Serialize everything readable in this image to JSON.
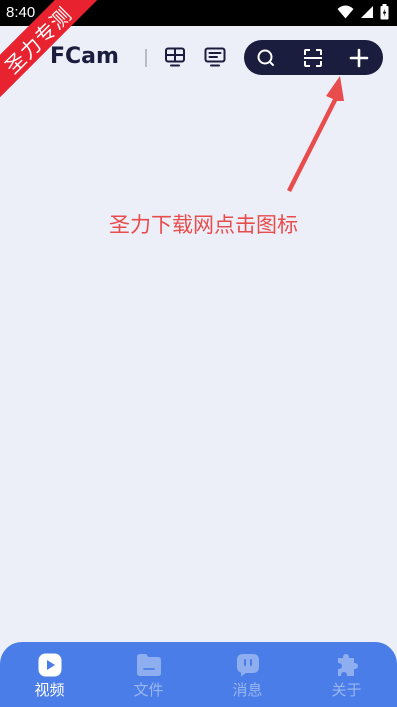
{
  "status_bar": {
    "time": "8:40",
    "icons": [
      "wifi-icon",
      "signal-icon",
      "battery-icon"
    ]
  },
  "ribbon": {
    "text": "圣力专测"
  },
  "header": {
    "brand": "FCam",
    "icons": [
      "grid-view-icon",
      "monitor-icon"
    ],
    "toolbar": [
      "search-icon",
      "scan-icon",
      "add-icon"
    ]
  },
  "annotation": {
    "text": "圣力下载网点击图标"
  },
  "bottom_nav": {
    "items": [
      {
        "label": "视频",
        "icon": "video-play-icon",
        "active": true
      },
      {
        "label": "文件",
        "icon": "folder-icon",
        "active": false
      },
      {
        "label": "消息",
        "icon": "message-icon",
        "active": false
      },
      {
        "label": "关于",
        "icon": "puzzle-icon",
        "active": false
      }
    ]
  },
  "colors": {
    "background": "#eceff7",
    "header_dark": "#1a1d3d",
    "annotation_red": "#e84c4c",
    "ribbon_red": "#e8232f",
    "nav_blue": "#4a7de8",
    "nav_inactive": "#9ab6f1"
  }
}
